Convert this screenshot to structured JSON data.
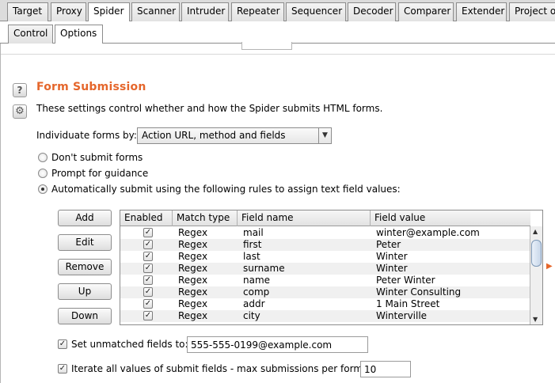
{
  "top_tabs": [
    "Target",
    "Proxy",
    "Spider",
    "Scanner",
    "Intruder",
    "Repeater",
    "Sequencer",
    "Decoder",
    "Comparer",
    "Extender",
    "Project o"
  ],
  "sub_tabs": [
    "Control",
    "Options"
  ],
  "section": {
    "title": "Form Submission",
    "help_icon": "?",
    "settings_icon": "⚙",
    "description": "These settings control whether and how the Spider submits HTML forms.",
    "individuate_label": "Individuate forms by:",
    "individuate_value": "Action URL, method and fields"
  },
  "radios": [
    {
      "label": "Don't submit forms",
      "checked": false
    },
    {
      "label": "Prompt for guidance",
      "checked": false
    },
    {
      "label": "Automatically submit using the following rules to assign text field values:",
      "checked": true
    }
  ],
  "buttons": {
    "add": "Add",
    "edit": "Edit",
    "remove": "Remove",
    "up": "Up",
    "down": "Down"
  },
  "table": {
    "headers": [
      "Enabled",
      "Match type",
      "Field name",
      "Field value"
    ],
    "rows": [
      {
        "enabled": true,
        "match": "Regex",
        "name": "mail",
        "value": "winter@example.com"
      },
      {
        "enabled": true,
        "match": "Regex",
        "name": "first",
        "value": "Peter"
      },
      {
        "enabled": true,
        "match": "Regex",
        "name": "last",
        "value": "Winter"
      },
      {
        "enabled": true,
        "match": "Regex",
        "name": "surname",
        "value": "Winter"
      },
      {
        "enabled": true,
        "match": "Regex",
        "name": "name",
        "value": "Peter Winter"
      },
      {
        "enabled": true,
        "match": "Regex",
        "name": "comp",
        "value": "Winter Consulting"
      },
      {
        "enabled": true,
        "match": "Regex",
        "name": "addr",
        "value": "1 Main Street"
      },
      {
        "enabled": true,
        "match": "Regex",
        "name": "city",
        "value": "Winterville"
      }
    ]
  },
  "unmatched": {
    "label": "Set unmatched fields to:",
    "checked": true,
    "value": "555-555-0199@example.com"
  },
  "iterate": {
    "label": "Iterate all values of submit fields - max submissions per form:",
    "checked": true,
    "value": "10"
  },
  "colors": {
    "accent": "#e5662b",
    "tab_border": "#8c8c8c",
    "alt_row": "#f0f0f0"
  },
  "icons": {
    "checkmark": "✓",
    "dropdown": "▼",
    "scroll_up": "▲",
    "scroll_down": "▼",
    "side_arrow": "▶"
  }
}
